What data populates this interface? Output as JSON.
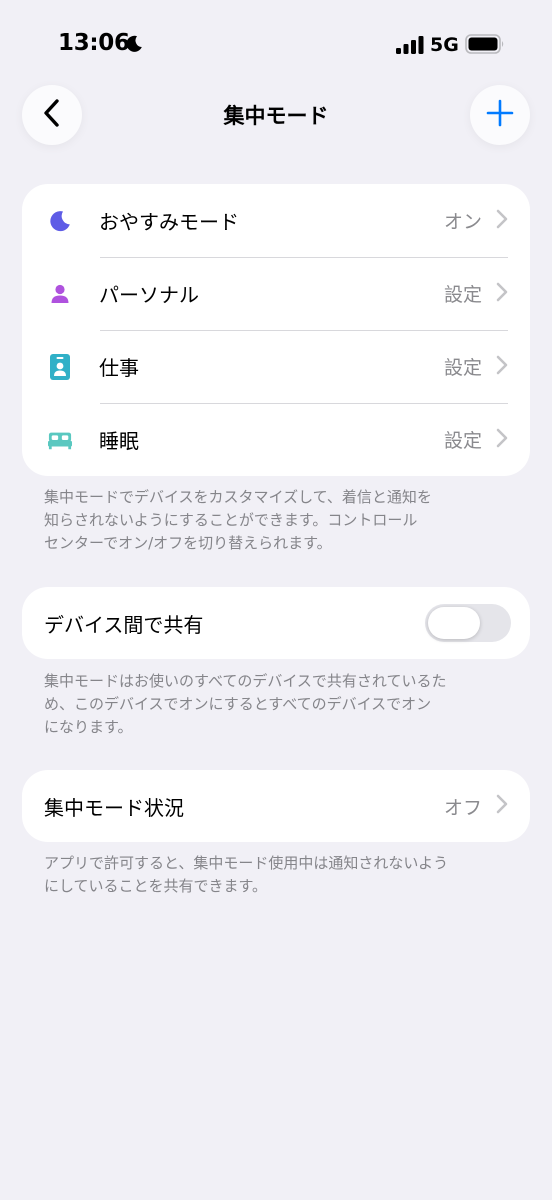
{
  "status_bar": {
    "time": "13:06",
    "network": "5G",
    "icons": [
      "moon-icon",
      "signal-icon",
      "battery-icon"
    ]
  },
  "nav": {
    "title": "集中モード",
    "back_icon": "chevron-left-icon",
    "add_icon": "plus-icon"
  },
  "focus_modes": [
    {
      "label": "おやすみモード",
      "value": "オン",
      "icon": "moon-icon",
      "color": "#5e5ce6"
    },
    {
      "label": "パーソナル",
      "value": "設定",
      "icon": "person-icon",
      "color": "#af52de"
    },
    {
      "label": "仕事",
      "value": "設定",
      "icon": "id-badge-icon",
      "color": "#30b0c7"
    },
    {
      "label": "睡眠",
      "value": "設定",
      "icon": "bed-icon",
      "color": "#5ac8c0"
    }
  ],
  "focus_footnote": [
    "集中モードでデバイスをカスタマイズして、着信と通知を",
    "知らされないようにすることができます。コントロール",
    "センターでオン/オフを切り替えられます。"
  ],
  "share": {
    "label": "デバイス間で共有",
    "enabled": false,
    "footnote": [
      "集中モードはお使いのすべてのデバイスで共有されているた",
      "め、このデバイスでオンにするとすべてのデバイスでオン",
      "になります。"
    ]
  },
  "status": {
    "label": "集中モード状況",
    "value": "オフ",
    "footnote": [
      "アプリで許可すると、集中モード使用中は通知されないよう",
      "にしていることを共有できます。"
    ]
  },
  "colors": {
    "background": "#f1f0f6",
    "accent": "#007aff",
    "secondary_text": "#8a8a8e"
  }
}
